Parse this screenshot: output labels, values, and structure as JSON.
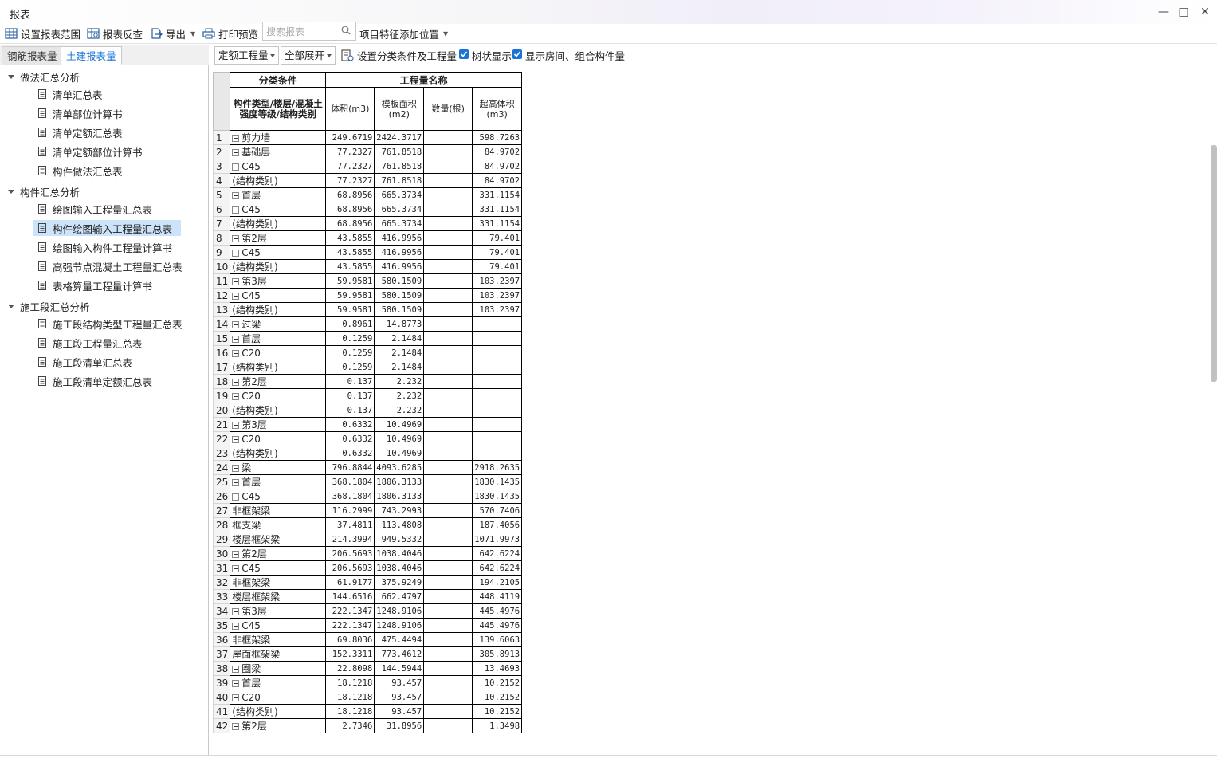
{
  "window": {
    "title": "报表"
  },
  "toolbar": {
    "set_range": "设置报表范围",
    "report_check": "报表反查",
    "export": "导出",
    "print_preview": "打印预览",
    "search_placeholder": "搜索报表",
    "feature_position": "项目特征添加位置"
  },
  "tabs": {
    "rebar": "钢筋报表量",
    "civil": "土建报表量"
  },
  "tree": {
    "groups": [
      {
        "label": "做法汇总分析",
        "items": [
          "清单汇总表",
          "清单部位计算书",
          "清单定额汇总表",
          "清单定额部位计算书",
          "构件做法汇总表"
        ]
      },
      {
        "label": "构件汇总分析",
        "items": [
          "绘图输入工程量汇总表",
          "构件绘图输入工程量汇总表",
          "绘图输入构件工程量计算书",
          "高强节点混凝土工程量汇总表",
          "表格算量工程量计算书"
        ]
      },
      {
        "label": "施工段汇总分析",
        "items": [
          "施工段结构类型工程量汇总表",
          "施工段工程量汇总表",
          "施工段清单汇总表",
          "施工段清单定额汇总表"
        ]
      }
    ],
    "selected": "构件绘图输入工程量汇总表"
  },
  "rtoolbar": {
    "quota_select": "定额工程量",
    "expand_select": "全部展开",
    "set_conditions": "设置分类条件及工程量",
    "tree_display": "树状显示",
    "show_rooms": "显示房间、组合构件量"
  },
  "table": {
    "header_group1": "分类条件",
    "header_group2": "工程量名称",
    "col_category": "构件类型/楼层/混凝土强度等级/结构类别",
    "col_volume": "体积(m3)",
    "col_formwork": "模板面积(m2)",
    "col_count": "数量(根)",
    "col_overheight": "超高体积(m3)",
    "rows": [
      {
        "n": "1",
        "level": 0,
        "exp": true,
        "name": "剪力墙",
        "v": "249.6719",
        "f": "2424.3717",
        "c": "",
        "o": "598.7263"
      },
      {
        "n": "2",
        "level": 1,
        "exp": true,
        "name": "基础层",
        "v": "77.2327",
        "f": "761.8518",
        "c": "",
        "o": "84.9702"
      },
      {
        "n": "3",
        "level": 2,
        "exp": true,
        "name": "C45",
        "v": "77.2327",
        "f": "761.8518",
        "c": "",
        "o": "84.9702"
      },
      {
        "n": "4",
        "level": 3,
        "exp": false,
        "name": "(结构类别)",
        "v": "77.2327",
        "f": "761.8518",
        "c": "",
        "o": "84.9702"
      },
      {
        "n": "5",
        "level": 1,
        "exp": true,
        "name": "首层",
        "v": "68.8956",
        "f": "665.3734",
        "c": "",
        "o": "331.1154"
      },
      {
        "n": "6",
        "level": 2,
        "exp": true,
        "name": "C45",
        "v": "68.8956",
        "f": "665.3734",
        "c": "",
        "o": "331.1154"
      },
      {
        "n": "7",
        "level": 3,
        "exp": false,
        "name": "(结构类别)",
        "v": "68.8956",
        "f": "665.3734",
        "c": "",
        "o": "331.1154"
      },
      {
        "n": "8",
        "level": 1,
        "exp": true,
        "name": "第2层",
        "v": "43.5855",
        "f": "416.9956",
        "c": "",
        "o": "79.401"
      },
      {
        "n": "9",
        "level": 2,
        "exp": true,
        "name": "C45",
        "v": "43.5855",
        "f": "416.9956",
        "c": "",
        "o": "79.401"
      },
      {
        "n": "10",
        "level": 3,
        "exp": false,
        "name": "(结构类别)",
        "v": "43.5855",
        "f": "416.9956",
        "c": "",
        "o": "79.401"
      },
      {
        "n": "11",
        "level": 1,
        "exp": true,
        "name": "第3层",
        "v": "59.9581",
        "f": "580.1509",
        "c": "",
        "o": "103.2397"
      },
      {
        "n": "12",
        "level": 2,
        "exp": true,
        "name": "C45",
        "v": "59.9581",
        "f": "580.1509",
        "c": "",
        "o": "103.2397"
      },
      {
        "n": "13",
        "level": 3,
        "exp": false,
        "name": "(结构类别)",
        "v": "59.9581",
        "f": "580.1509",
        "c": "",
        "o": "103.2397"
      },
      {
        "n": "14",
        "level": 0,
        "exp": true,
        "name": "过梁",
        "v": "0.8961",
        "f": "14.8773",
        "c": "",
        "o": ""
      },
      {
        "n": "15",
        "level": 1,
        "exp": true,
        "name": "首层",
        "v": "0.1259",
        "f": "2.1484",
        "c": "",
        "o": ""
      },
      {
        "n": "16",
        "level": 2,
        "exp": true,
        "name": "C20",
        "v": "0.1259",
        "f": "2.1484",
        "c": "",
        "o": ""
      },
      {
        "n": "17",
        "level": 3,
        "exp": false,
        "name": "(结构类别)",
        "v": "0.1259",
        "f": "2.1484",
        "c": "",
        "o": ""
      },
      {
        "n": "18",
        "level": 1,
        "exp": true,
        "name": "第2层",
        "v": "0.137",
        "f": "2.232",
        "c": "",
        "o": ""
      },
      {
        "n": "19",
        "level": 2,
        "exp": true,
        "name": "C20",
        "v": "0.137",
        "f": "2.232",
        "c": "",
        "o": ""
      },
      {
        "n": "20",
        "level": 3,
        "exp": false,
        "name": "(结构类别)",
        "v": "0.137",
        "f": "2.232",
        "c": "",
        "o": ""
      },
      {
        "n": "21",
        "level": 1,
        "exp": true,
        "name": "第3层",
        "v": "0.6332",
        "f": "10.4969",
        "c": "",
        "o": ""
      },
      {
        "n": "22",
        "level": 2,
        "exp": true,
        "name": "C20",
        "v": "0.6332",
        "f": "10.4969",
        "c": "",
        "o": ""
      },
      {
        "n": "23",
        "level": 3,
        "exp": false,
        "name": "(结构类别)",
        "v": "0.6332",
        "f": "10.4969",
        "c": "",
        "o": ""
      },
      {
        "n": "24",
        "level": 0,
        "exp": true,
        "name": "梁",
        "v": "796.8844",
        "f": "4093.6285",
        "c": "",
        "o": "2918.2635"
      },
      {
        "n": "25",
        "level": 1,
        "exp": true,
        "name": "首层",
        "v": "368.1804",
        "f": "1806.3133",
        "c": "",
        "o": "1830.1435"
      },
      {
        "n": "26",
        "level": 2,
        "exp": true,
        "name": "C45",
        "v": "368.1804",
        "f": "1806.3133",
        "c": "",
        "o": "1830.1435"
      },
      {
        "n": "27",
        "level": 3,
        "exp": false,
        "name": "非框架梁",
        "v": "116.2999",
        "f": "743.2993",
        "c": "",
        "o": "570.7406"
      },
      {
        "n": "28",
        "level": 3,
        "exp": false,
        "name": "框支梁",
        "v": "37.4811",
        "f": "113.4808",
        "c": "",
        "o": "187.4056"
      },
      {
        "n": "29",
        "level": 3,
        "exp": false,
        "name": "楼层框架梁",
        "v": "214.3994",
        "f": "949.5332",
        "c": "",
        "o": "1071.9973"
      },
      {
        "n": "30",
        "level": 1,
        "exp": true,
        "name": "第2层",
        "v": "206.5693",
        "f": "1038.4046",
        "c": "",
        "o": "642.6224"
      },
      {
        "n": "31",
        "level": 2,
        "exp": true,
        "name": "C45",
        "v": "206.5693",
        "f": "1038.4046",
        "c": "",
        "o": "642.6224"
      },
      {
        "n": "32",
        "level": 3,
        "exp": false,
        "name": "非框架梁",
        "v": "61.9177",
        "f": "375.9249",
        "c": "",
        "o": "194.2105"
      },
      {
        "n": "33",
        "level": 3,
        "exp": false,
        "name": "楼层框架梁",
        "v": "144.6516",
        "f": "662.4797",
        "c": "",
        "o": "448.4119"
      },
      {
        "n": "34",
        "level": 1,
        "exp": true,
        "name": "第3层",
        "v": "222.1347",
        "f": "1248.9106",
        "c": "",
        "o": "445.4976"
      },
      {
        "n": "35",
        "level": 2,
        "exp": true,
        "name": "C45",
        "v": "222.1347",
        "f": "1248.9106",
        "c": "",
        "o": "445.4976"
      },
      {
        "n": "36",
        "level": 3,
        "exp": false,
        "name": "非框架梁",
        "v": "69.8036",
        "f": "475.4494",
        "c": "",
        "o": "139.6063"
      },
      {
        "n": "37",
        "level": 3,
        "exp": false,
        "name": "屋面框架梁",
        "v": "152.3311",
        "f": "773.4612",
        "c": "",
        "o": "305.8913"
      },
      {
        "n": "38",
        "level": 0,
        "exp": true,
        "name": "圈梁",
        "v": "22.8098",
        "f": "144.5944",
        "c": "",
        "o": "13.4693"
      },
      {
        "n": "39",
        "level": 1,
        "exp": true,
        "name": "首层",
        "v": "18.1218",
        "f": "93.457",
        "c": "",
        "o": "10.2152"
      },
      {
        "n": "40",
        "level": 2,
        "exp": true,
        "name": "C20",
        "v": "18.1218",
        "f": "93.457",
        "c": "",
        "o": "10.2152"
      },
      {
        "n": "41",
        "level": 3,
        "exp": false,
        "name": "(结构类别)",
        "v": "18.1218",
        "f": "93.457",
        "c": "",
        "o": "10.2152"
      },
      {
        "n": "42",
        "level": 1,
        "exp": true,
        "name": "第2层",
        "v": "2.7346",
        "f": "31.8956",
        "c": "",
        "o": "1.3498"
      }
    ]
  }
}
